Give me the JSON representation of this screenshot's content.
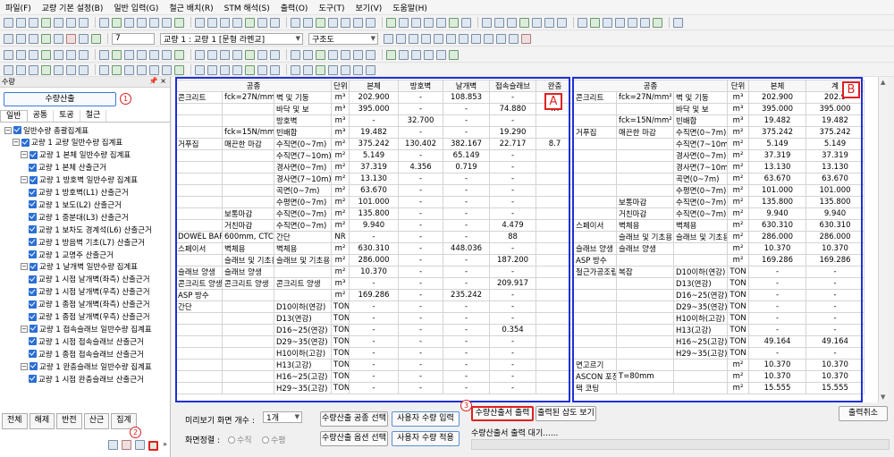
{
  "menu": [
    "파일(F)",
    "교량 기본 설정(B)",
    "일반 입력(G)",
    "철근 배치(R)",
    "STM 해석(S)",
    "출력(O)",
    "도구(T)",
    "보기(V)",
    "도움말(H)"
  ],
  "toolbar": {
    "number_value": "7",
    "bridge_combo": "교량 1 : 교량 1 [문형 라멘교]",
    "view_combo": "구조도"
  },
  "left_panel": {
    "title": "수량",
    "calc_button": "수량산출",
    "markers": [
      "1",
      "2"
    ],
    "tabs": [
      "일반",
      "공통",
      "토공",
      "철근"
    ],
    "tree": [
      {
        "label": "일반수량 총괄집계표",
        "level": 0
      },
      {
        "label": "교량 1 교량 일반수량 집계표",
        "level": 1
      },
      {
        "label": "교량 1 본체 일반수량 집계표",
        "level": 2
      },
      {
        "label": "교량 1 본체 산출근거",
        "level": 3
      },
      {
        "label": "교량 1 방호벽 일반수량 집계표",
        "level": 2
      },
      {
        "label": "교량 1 방호벽(L1) 산출근거",
        "level": 3
      },
      {
        "label": "교량 1 보도(L2) 산출근거",
        "level": 3
      },
      {
        "label": "교량 1 중분대(L3) 산출근거",
        "level": 3
      },
      {
        "label": "교량 1 보차도 경계석(L6) 산출근거",
        "level": 3
      },
      {
        "label": "교량 1 방음벽 기초(L7) 산출근거",
        "level": 3
      },
      {
        "label": "교량 1 교명주 산출근거",
        "level": 3
      },
      {
        "label": "교량 1 날개벽 일반수량 집계표",
        "level": 2
      },
      {
        "label": "교량 1 시점 날개벽(좌측) 산출근거",
        "level": 3
      },
      {
        "label": "교량 1 시점 날개벽(우측) 산출근거",
        "level": 3
      },
      {
        "label": "교량 1 종점 날개벽(좌측) 산출근거",
        "level": 3
      },
      {
        "label": "교량 1 종점 날개벽(우측) 산출근거",
        "level": 3
      },
      {
        "label": "교량 1 접속슬래브 일반수량 집계표",
        "level": 2
      },
      {
        "label": "교량 1 시점 접속슬래브 산출근거",
        "level": 3
      },
      {
        "label": "교량 1 종점 접속슬래브 산출근거",
        "level": 3
      },
      {
        "label": "교량 1 완충슬래브 일반수량 집계표",
        "level": 2
      },
      {
        "label": "교량 1 시점 완충슬래브 산출근거",
        "level": 3
      }
    ],
    "buttons": [
      "전체",
      "해제",
      "반전",
      "산근",
      "집계"
    ]
  },
  "table_a": {
    "label": "A",
    "headers": [
      "공종",
      "단위",
      "본체",
      "방호벽",
      "날개벽",
      "접속슬래브",
      "완충"
    ],
    "rows": [
      [
        "콘크리트",
        "fck=27N/mm²",
        "벽 및 기둥",
        "m³",
        "202.900",
        "-",
        "108.853",
        "-",
        ""
      ],
      [
        "",
        "",
        "바닥 및 보",
        "m³",
        "395.000",
        "-",
        "-",
        "74.880",
        "4.7"
      ],
      [
        "",
        "",
        "방호벽",
        "m³",
        "-",
        "32.700",
        "-",
        "-",
        ""
      ],
      [
        "",
        "fck=15N/mm²",
        "빈배합",
        "m³",
        "19.482",
        "-",
        "-",
        "19.290",
        ""
      ],
      [
        "거푸집",
        "매끈한 마감",
        "수직면(0~7m)",
        "m²",
        "375.242",
        "130.402",
        "382.167",
        "22.717",
        "8.7"
      ],
      [
        "",
        "",
        "수직면(7~10m)",
        "m²",
        "5.149",
        "-",
        "65.149",
        "-",
        ""
      ],
      [
        "",
        "",
        "경사면(0~7m)",
        "m²",
        "37.319",
        "4.356",
        "0.719",
        "-",
        ""
      ],
      [
        "",
        "",
        "경사면(7~10m)",
        "m²",
        "13.130",
        "-",
        "-",
        "-",
        ""
      ],
      [
        "",
        "",
        "곡면(0~7m)",
        "m²",
        "63.670",
        "-",
        "-",
        "-",
        ""
      ],
      [
        "",
        "",
        "수평면(0~7m)",
        "m²",
        "101.000",
        "-",
        "-",
        "-",
        ""
      ],
      [
        "",
        "보통마감",
        "수직면(0~7m)",
        "m²",
        "135.800",
        "-",
        "-",
        "-",
        ""
      ],
      [
        "",
        "거친마감",
        "수직면(0~7m)",
        "m²",
        "9.940",
        "-",
        "-",
        "4.479",
        ""
      ],
      [
        "DOWEL BAR",
        "600mm, CTC=",
        "간단",
        "NR",
        "-",
        "-",
        "-",
        "88",
        ""
      ],
      [
        "스페이서",
        "벽체용",
        "벽체용",
        "m²",
        "630.310",
        "-",
        "448.036",
        "-",
        ""
      ],
      [
        "",
        "슬래브 및 기초용",
        "슬래브 및 기초용",
        "m²",
        "286.000",
        "-",
        "-",
        "187.200",
        ""
      ],
      [
        "슬래브 양생",
        "슬래브 양생",
        "",
        "m²",
        "10.370",
        "-",
        "-",
        "-",
        ""
      ],
      [
        "콘크리트 양생",
        "콘크리트 양생",
        "콘크리트 양생",
        "m³",
        "-",
        "-",
        "-",
        "209.917",
        ""
      ],
      [
        "ASP 방수",
        "",
        "",
        "m²",
        "169.286",
        "-",
        "235.242",
        "-",
        ""
      ],
      [
        "간단",
        "",
        "D10이하(연강)",
        "TON",
        "-",
        "-",
        "-",
        "-",
        ""
      ],
      [
        "",
        "",
        "D13(연강)",
        "TON",
        "-",
        "-",
        "-",
        "-",
        ""
      ],
      [
        "",
        "",
        "D16~25(연강)",
        "TON",
        "-",
        "-",
        "-",
        "0.354",
        ""
      ],
      [
        "",
        "",
        "D29~35(연강)",
        "TON",
        "-",
        "-",
        "-",
        "-",
        ""
      ],
      [
        "",
        "",
        "H10이하(고강)",
        "TON",
        "-",
        "-",
        "-",
        "-",
        ""
      ],
      [
        "",
        "",
        "H13(고강)",
        "TON",
        "-",
        "-",
        "-",
        "-",
        ""
      ],
      [
        "",
        "",
        "H16~25(고강)",
        "TON",
        "-",
        "-",
        "-",
        "-",
        ""
      ],
      [
        "",
        "",
        "H29~35(고강)",
        "TON",
        "-",
        "-",
        "-",
        "-",
        ""
      ]
    ]
  },
  "table_b": {
    "label": "B",
    "headers": [
      "공종",
      "단위",
      "본체",
      "계"
    ],
    "rows": [
      [
        "콘크리트",
        "fck=27N/mm²",
        "벽 및 기둥",
        "m³",
        "202.900",
        "202.9"
      ],
      [
        "",
        "",
        "바닥 및 보",
        "m³",
        "395.000",
        "395.000"
      ],
      [
        "",
        "fck=15N/mm²",
        "빈배합",
        "m³",
        "19.482",
        "19.482"
      ],
      [
        "거푸집",
        "매끈한 마감",
        "수직면(0~7m)",
        "m²",
        "375.242",
        "375.242"
      ],
      [
        "",
        "",
        "수직면(7~10m)",
        "m²",
        "5.149",
        "5.149"
      ],
      [
        "",
        "",
        "경사면(0~7m)",
        "m²",
        "37.319",
        "37.319"
      ],
      [
        "",
        "",
        "경사면(7~10m)",
        "m²",
        "13.130",
        "13.130"
      ],
      [
        "",
        "",
        "곡면(0~7m)",
        "m²",
        "63.670",
        "63.670"
      ],
      [
        "",
        "",
        "수평면(0~7m)",
        "m²",
        "101.000",
        "101.000"
      ],
      [
        "",
        "보통마감",
        "수직면(0~7m)",
        "m²",
        "135.800",
        "135.800"
      ],
      [
        "",
        "거친마감",
        "수직면(0~7m)",
        "m²",
        "9.940",
        "9.940"
      ],
      [
        "스페이서",
        "벽체용",
        "벽체용",
        "m²",
        "630.310",
        "630.310"
      ],
      [
        "",
        "슬래브 및 기초용",
        "슬래브 및 기초용",
        "m²",
        "286.000",
        "286.000"
      ],
      [
        "슬래브 양생",
        "슬래브 양생",
        "",
        "m²",
        "10.370",
        "10.370"
      ],
      [
        "ASP 방수",
        "",
        "",
        "m²",
        "169.286",
        "169.286"
      ],
      [
        "철근가공조립",
        "복잡",
        "D10이하(연강)",
        "TON",
        "-",
        "-"
      ],
      [
        "",
        "",
        "D13(연강)",
        "TON",
        "-",
        "-"
      ],
      [
        "",
        "",
        "D16~25(연강)",
        "TON",
        "-",
        "-"
      ],
      [
        "",
        "",
        "D29~35(연강)",
        "TON",
        "-",
        "-"
      ],
      [
        "",
        "",
        "H10이하(고강)",
        "TON",
        "-",
        "-"
      ],
      [
        "",
        "",
        "H13(고강)",
        "TON",
        "-",
        "-"
      ],
      [
        "",
        "",
        "H16~25(고강)",
        "TON",
        "49.164",
        "49.164"
      ],
      [
        "",
        "",
        "H29~35(고강)",
        "TON",
        "-",
        "-"
      ],
      [
        "면고르기",
        "",
        "",
        "m²",
        "10.370",
        "10.370"
      ],
      [
        "ASCON 포장",
        "T=80mm",
        "",
        "m²",
        "10.370",
        "10.370"
      ],
      [
        "택 코팅",
        "",
        "",
        "m²",
        "15.555",
        "15.555"
      ]
    ]
  },
  "bottom": {
    "preview_label": "미리보기 화면 개수 :",
    "preview_count": "1개",
    "sort_label": "화면정렬 :",
    "sort_vertical": "수직",
    "sort_horizontal": "수평",
    "btn_process_select": "수량산출 공종 선택",
    "btn_option_select": "수량산출 옵션 선택",
    "btn_user_input": "사용자 수량 입력",
    "btn_user_apply": "사용자 수량 적용",
    "btn_output": "수량산출서 출력",
    "btn_view_drawing": "출력된 삽도 보기",
    "btn_cancel": "출력취소",
    "marker_3": "3",
    "status": "수량산출서 출력 대기......"
  },
  "colors": {
    "highlight_blue": "#1f2fd6",
    "marker_red": "#e02020",
    "checkbox_blue": "#2b6fd4"
  }
}
